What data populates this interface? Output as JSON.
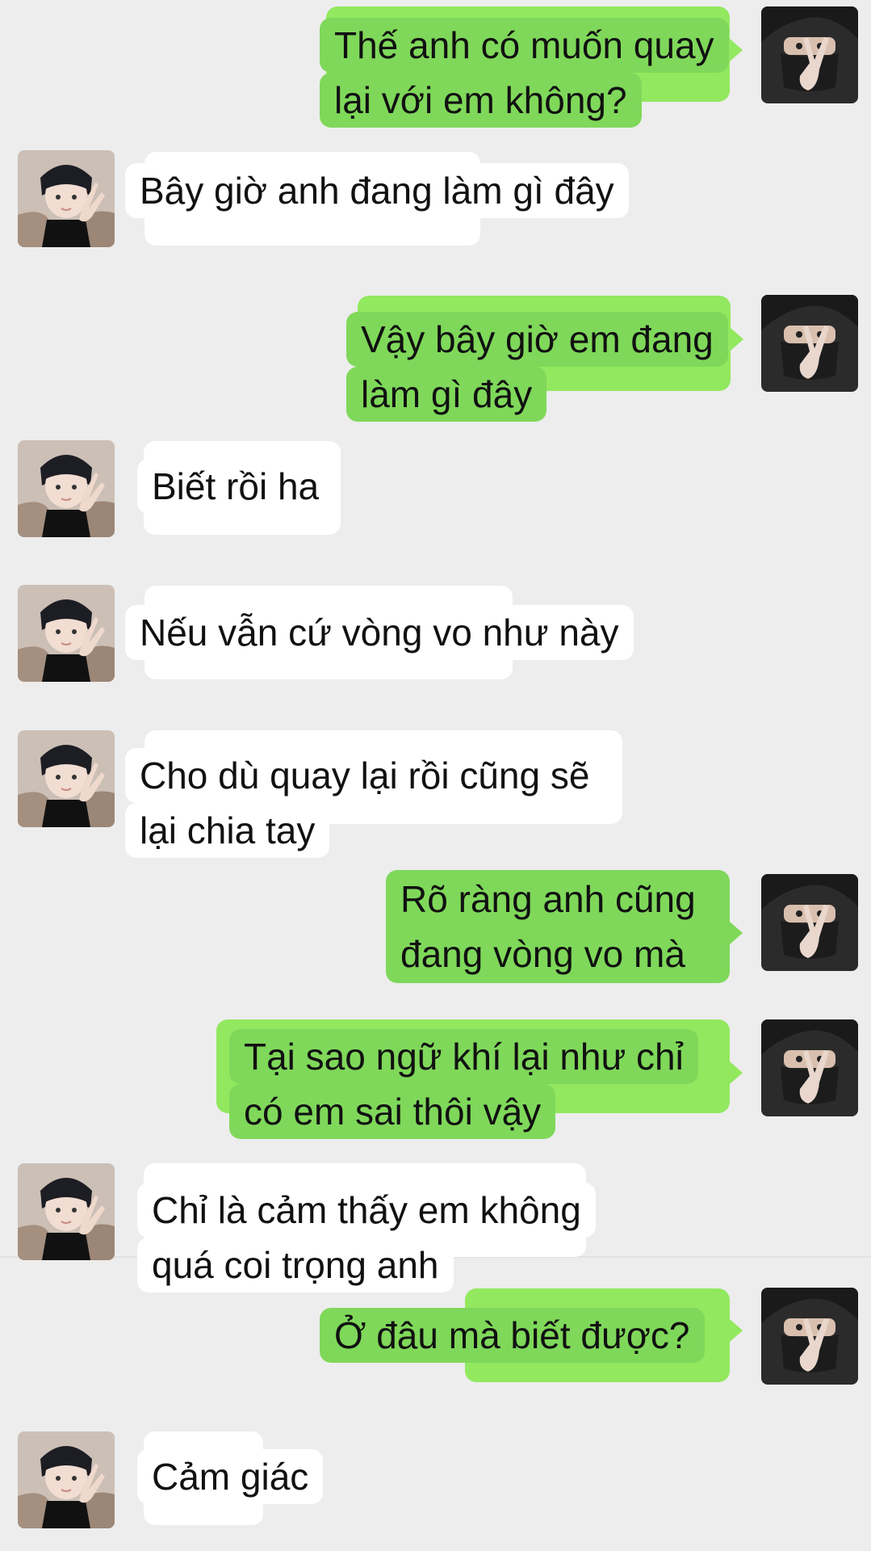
{
  "chat": {
    "messages": [
      {
        "side": "right",
        "lines": [
          "Thế anh có muốn quay",
          "lại với em không?"
        ]
      },
      {
        "side": "left",
        "lines": [
          "Bây giờ anh đang làm gì đây"
        ]
      },
      {
        "side": "right",
        "lines": [
          "Vậy bây giờ em đang",
          "làm gì đây"
        ]
      },
      {
        "side": "left",
        "lines": [
          "Biết rồi ha"
        ]
      },
      {
        "side": "left",
        "lines": [
          "Nếu vẫn cứ vòng vo như này"
        ]
      },
      {
        "side": "left",
        "lines": [
          "Cho dù quay lại rồi cũng sẽ",
          "lại chia tay"
        ]
      },
      {
        "side": "right",
        "lines": [
          "Rõ ràng anh cũng",
          "đang vòng vo mà"
        ]
      },
      {
        "side": "right",
        "lines": [
          "Tại sao ngữ khí lại như chỉ",
          "có em sai thôi vậy"
        ]
      },
      {
        "side": "left",
        "lines": [
          "Chỉ là cảm thấy em không",
          "quá coi trọng anh"
        ]
      },
      {
        "side": "right",
        "lines": [
          "Ở đâu mà biết được?"
        ]
      },
      {
        "side": "left",
        "lines": [
          "Cảm giác"
        ]
      }
    ]
  },
  "colors": {
    "background": "#ededed",
    "bubble_left": "#ffffff",
    "bubble_right": "#7fd85a",
    "bubble_right_back": "#92e85f"
  },
  "icons": {
    "left_avatar": "boy-avatar-icon",
    "right_avatar": "masked-boy-avatar-icon"
  }
}
